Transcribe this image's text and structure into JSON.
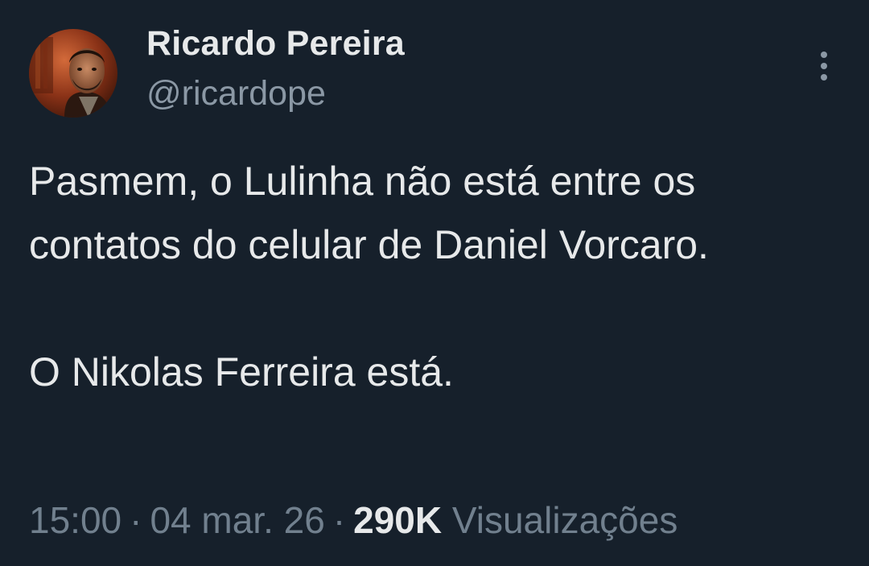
{
  "author": {
    "display_name": "Ricardo Pereira",
    "handle": "@ricardope"
  },
  "tweet": {
    "text": "Pasmem, o Lulinha não está entre os contatos do celular de Daniel Vorcaro.\n\nO Nikolas Ferreira está.",
    "time": "15:00",
    "date": "04 mar. 26",
    "separator": "·",
    "views_count": "290K",
    "views_label": "Visualizações"
  },
  "icons": {
    "more": "more-vertical-icon",
    "avatar": "avatar-photo"
  },
  "colors": {
    "background": "#16202b",
    "primary_text": "#e7e9ea",
    "secondary_text": "#8b98a5"
  }
}
